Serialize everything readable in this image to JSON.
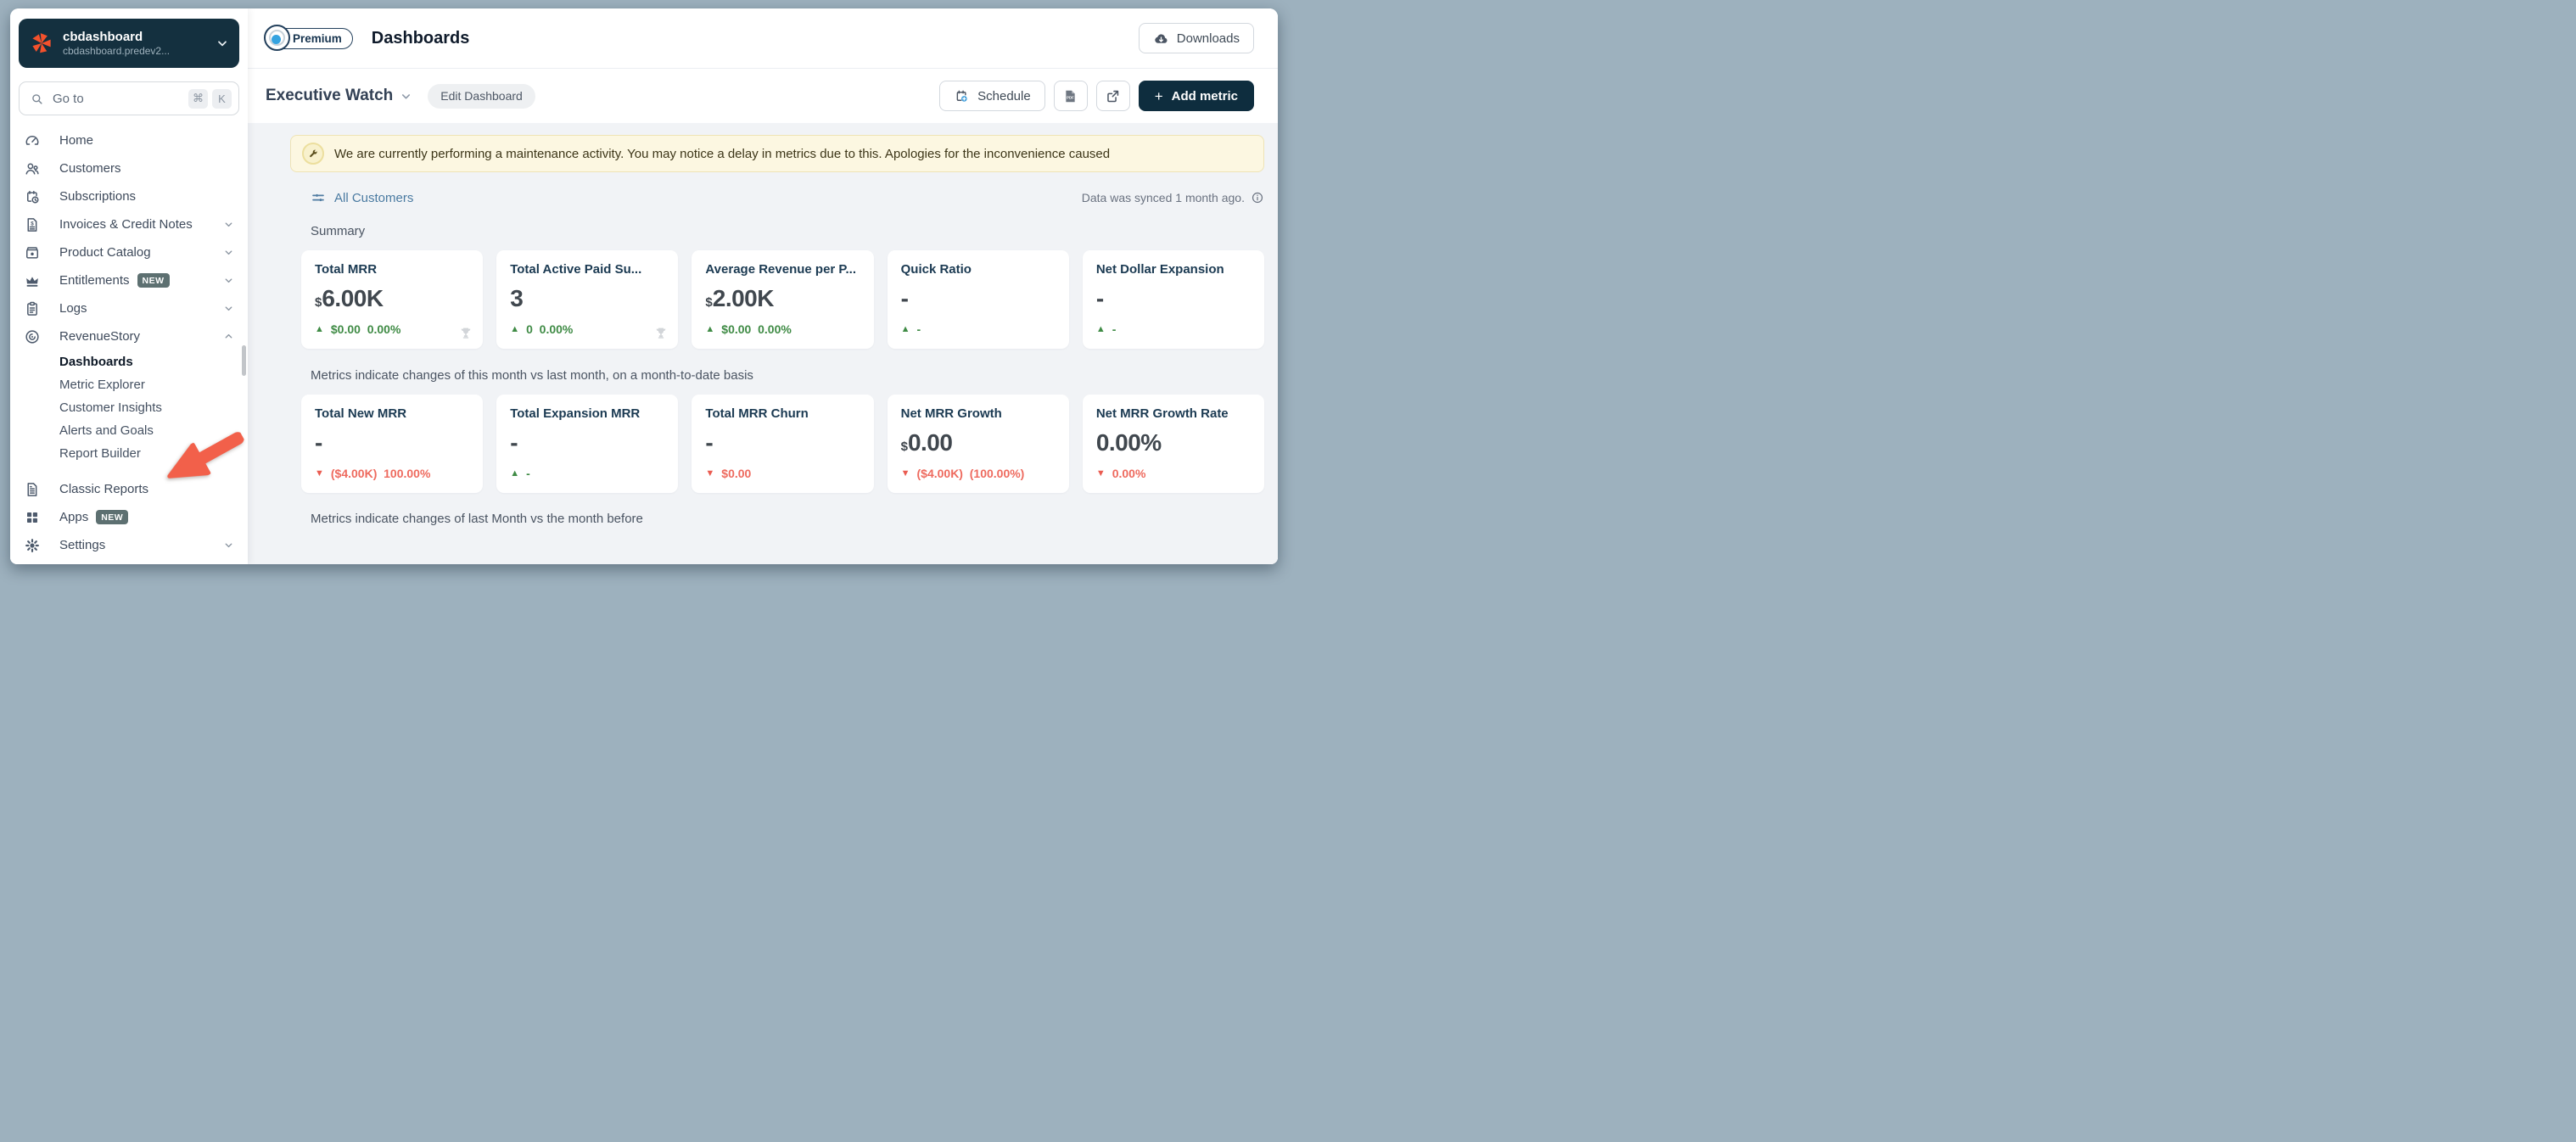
{
  "colors": {
    "frame_background": "#9db1be",
    "sidebar_org_background": "#14303f",
    "brand_logo_orange": "#f4512c",
    "primary_button_background": "#0e2d3e",
    "banner_background": "#fcf7e1",
    "banner_border": "#eee3b5",
    "positive_green": "#3f8b45",
    "negative_red": "#ee6a5e",
    "link_blue": "#4a7aa1",
    "annotation_arrow_red": "#f2604a"
  },
  "sidebar": {
    "org": {
      "name": "cbdashboard",
      "domain": "cbdashboard.predev2...",
      "logo_icon": "chargebee-logo-icon",
      "chevron_icon": "chevron-down-icon"
    },
    "search": {
      "placeholder": "Go to",
      "icon": "search-icon",
      "keys": [
        "⌘",
        "K"
      ]
    },
    "items": [
      {
        "label": "Home",
        "icon": "gauge-icon"
      },
      {
        "label": "Customers",
        "icon": "customers-icon"
      },
      {
        "label": "Subscriptions",
        "icon": "subscriptions-icon"
      },
      {
        "label": "Invoices & Credit Notes",
        "icon": "invoice-icon",
        "chevron": "down"
      },
      {
        "label": "Product Catalog",
        "icon": "product-catalog-icon",
        "chevron": "down"
      },
      {
        "label": "Entitlements",
        "icon": "crown-icon",
        "badge": "NEW",
        "chevron": "down"
      },
      {
        "label": "Logs",
        "icon": "logs-icon",
        "chevron": "down"
      },
      {
        "label": "RevenueStory",
        "icon": "revenuestory-icon",
        "chevron": "up"
      },
      {
        "label": "Dashboards",
        "indent": true,
        "active": true
      },
      {
        "label": "Metric Explorer",
        "indent": true
      },
      {
        "label": "Customer Insights",
        "indent": true
      },
      {
        "label": "Alerts and Goals",
        "indent": true
      },
      {
        "label": "Report Builder",
        "indent": true
      },
      {
        "label": "Classic Reports",
        "icon": "classic-reports-icon",
        "gap_before": true
      },
      {
        "label": "Apps",
        "icon": "apps-icon",
        "badge": "NEW"
      },
      {
        "label": "Settings",
        "icon": "gear-icon",
        "chevron": "down"
      }
    ]
  },
  "header": {
    "premium_label": "Premium",
    "premium_icon": "premium-gem-icon",
    "title": "Dashboards",
    "downloads_label": "Downloads",
    "downloads_icon": "cloud-download-icon"
  },
  "toolbar": {
    "dashboard_name": "Executive Watch",
    "edit_label": "Edit Dashboard",
    "schedule_label": "Schedule",
    "schedule_icon": "calendar-plus-icon",
    "pdf_icon": "pdf-export-icon",
    "share_icon": "share-icon",
    "add_metric_plus": "+",
    "add_metric_label": "Add metric"
  },
  "banner": {
    "icon": "wrench-icon",
    "text": "We are currently performing a maintenance activity. You may notice a delay in metrics due to this. Apologies for the inconvenience caused"
  },
  "filter": {
    "icon": "sliders-icon",
    "label": "All Customers"
  },
  "sync": {
    "text": "Data was synced 1 month ago.",
    "icon": "info-icon"
  },
  "summary": {
    "heading": "Summary",
    "cards": [
      {
        "title": "Total MRR",
        "prefix": "$",
        "value": "6.00K",
        "delta": {
          "direction": "up",
          "text": "$0.00  0.00%"
        },
        "trophy": true
      },
      {
        "title": "Total Active Paid Su...",
        "prefix": "",
        "value": "3",
        "delta": {
          "direction": "up",
          "text": "0  0.00%"
        },
        "trophy": true
      },
      {
        "title": "Average Revenue per P...",
        "prefix": "$",
        "value": "2.00K",
        "delta": {
          "direction": "up",
          "text": "$0.00  0.00%"
        },
        "trophy": false
      },
      {
        "title": "Quick Ratio",
        "prefix": "",
        "value": "-",
        "delta": {
          "direction": "up",
          "text": "-"
        },
        "trophy": false
      },
      {
        "title": "Net Dollar Expansion",
        "prefix": "",
        "value": "-",
        "delta": {
          "direction": "up",
          "text": "-"
        },
        "trophy": false
      }
    ],
    "note": "Metrics indicate changes of this month vs last month, on a month-to-date basis"
  },
  "monthly": {
    "cards": [
      {
        "title": "Total New MRR",
        "prefix": "",
        "value": "-",
        "delta": {
          "direction": "down",
          "text": "($4.00K)  100.00%"
        },
        "trophy": false
      },
      {
        "title": "Total Expansion MRR",
        "prefix": "",
        "value": "-",
        "delta": {
          "direction": "up",
          "text": "-"
        },
        "trophy": false
      },
      {
        "title": "Total MRR Churn",
        "prefix": "",
        "value": "-",
        "delta": {
          "direction": "down",
          "text": "$0.00"
        },
        "trophy": false
      },
      {
        "title": "Net MRR Growth",
        "prefix": "$",
        "value": "0.00",
        "delta": {
          "direction": "down",
          "text": "($4.00K)  (100.00%)"
        },
        "trophy": false
      },
      {
        "title": "Net MRR Growth Rate",
        "prefix": "",
        "value": "0.00%",
        "delta": {
          "direction": "down",
          "text": "0.00%"
        },
        "trophy": false
      }
    ],
    "note": "Metrics indicate changes of last Month vs the month before"
  },
  "annotation": {
    "arrow": "red-arrow pointing at Classic Reports"
  }
}
